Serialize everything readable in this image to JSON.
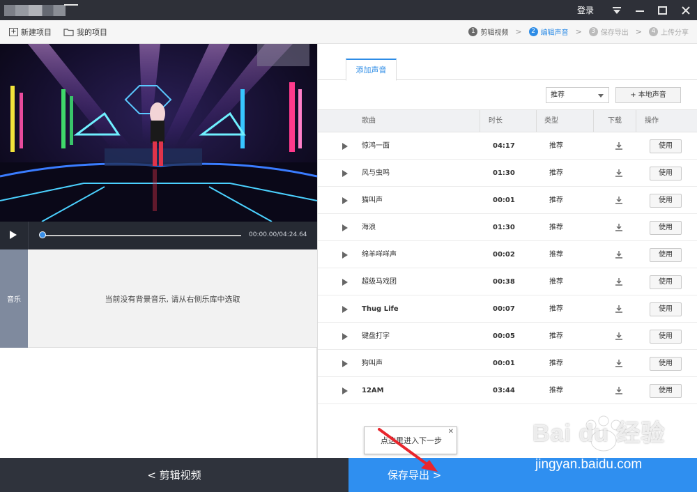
{
  "titlebar": {
    "login": "登录",
    "icons": [
      "dropdown-icon",
      "minimize-icon",
      "maximize-icon",
      "close-icon"
    ]
  },
  "toolbar": {
    "new_project": "新建项目",
    "my_projects": "我的项目"
  },
  "steps": [
    {
      "num": "1",
      "label": "剪辑视频",
      "state": "done"
    },
    {
      "num": "2",
      "label": "编辑声音",
      "state": "active"
    },
    {
      "num": "3",
      "label": "保存导出",
      "state": "pending"
    },
    {
      "num": "4",
      "label": "上传分享",
      "state": "pending"
    }
  ],
  "player": {
    "time": "00:00.00/04:24.64"
  },
  "music_track": {
    "label": "音乐",
    "empty_message": "当前没有背景音乐, 请从右侧乐库中选取"
  },
  "sound_panel": {
    "tab": "添加声音",
    "filter_selected": "推荐",
    "local_sound_button": "+ 本地声音",
    "columns": [
      "歌曲",
      "时长",
      "类型",
      "下载",
      "操作"
    ],
    "rows": [
      {
        "name": "惊鸿一面",
        "duration": "04:17",
        "type": "推荐",
        "action": "使用"
      },
      {
        "name": "风与虫鸣",
        "duration": "01:30",
        "type": "推荐",
        "action": "使用"
      },
      {
        "name": "猫叫声",
        "duration": "00:01",
        "type": "推荐",
        "action": "使用"
      },
      {
        "name": "海浪",
        "duration": "01:30",
        "type": "推荐",
        "action": "使用"
      },
      {
        "name": "绵羊咩咩声",
        "duration": "00:02",
        "type": "推荐",
        "action": "使用"
      },
      {
        "name": "超级马戏团",
        "duration": "00:38",
        "type": "推荐",
        "action": "使用"
      },
      {
        "name": "Thug Life",
        "duration": "00:07",
        "type": "推荐",
        "action": "使用"
      },
      {
        "name": "键盘打字",
        "duration": "00:05",
        "type": "推荐",
        "action": "使用"
      },
      {
        "name": "狗叫声",
        "duration": "00:01",
        "type": "推荐",
        "action": "使用"
      },
      {
        "name": "12AM",
        "duration": "03:44",
        "type": "推荐",
        "action": "使用"
      }
    ]
  },
  "tooltip": {
    "text": "点这里进入下一步"
  },
  "bottom": {
    "back": "<  剪辑视频",
    "next": "保存导出  >"
  },
  "watermark": {
    "brand": "Bai du 经验",
    "url": "jingyan.baidu.com"
  },
  "colors": {
    "accent": "#2d8ce6",
    "titlebar": "#2e3038",
    "next_button": "#2f8ff0",
    "annotation_arrow": "#e8262d"
  }
}
